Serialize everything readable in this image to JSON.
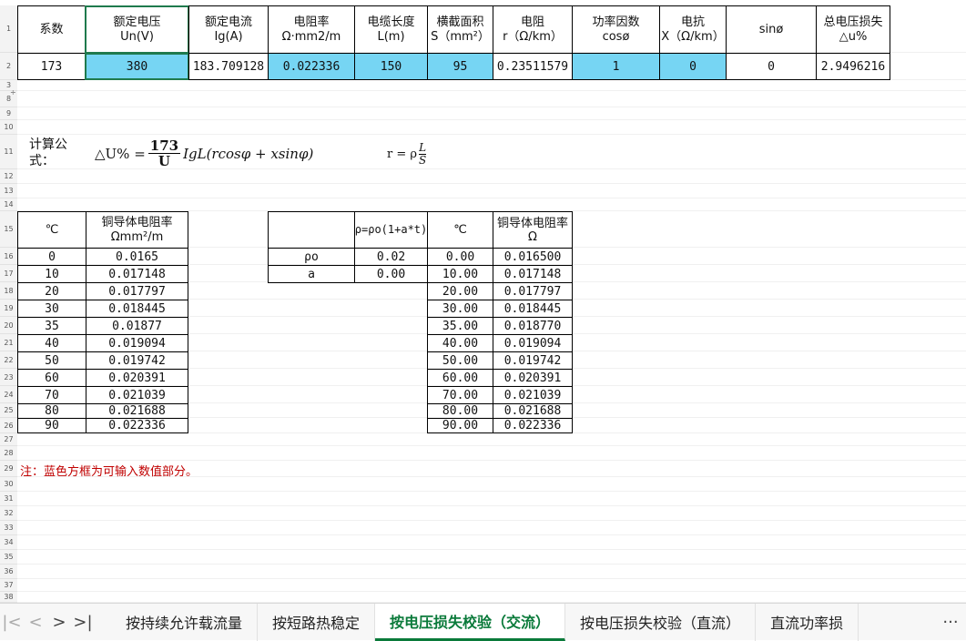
{
  "row_headers": [
    "1",
    "2",
    "3",
    "8",
    "9",
    "10",
    "11",
    "12",
    "13",
    "14",
    "15",
    "16",
    "17",
    "18",
    "19",
    "20",
    "21",
    "22",
    "23",
    "24",
    "25",
    "26",
    "27",
    "28",
    "29",
    "30",
    "31",
    "32",
    "33",
    "34",
    "35",
    "36",
    "37",
    "38"
  ],
  "main_table": {
    "headers": [
      [
        "系数",
        ""
      ],
      [
        "额定电压",
        "Un(V)"
      ],
      [
        "额定电流",
        "Ig(A)"
      ],
      [
        "电阻率",
        "Ω·mm2/m"
      ],
      [
        "电缆长度",
        "L(m)"
      ],
      [
        "横截面积",
        "S（mm²）"
      ],
      [
        "电阻",
        "r（Ω/km）"
      ],
      [
        "功率因数",
        "cosø"
      ],
      [
        "电抗",
        "X（Ω/km）"
      ],
      [
        "sinø",
        ""
      ],
      [
        "总电压损失",
        "△u%"
      ]
    ],
    "values": [
      "173",
      "380",
      "183.709128",
      "0.022336",
      "150",
      "95",
      "0.23511579",
      "1",
      "0",
      "0",
      "2.9496216"
    ]
  },
  "formula": {
    "label": "计算公式：",
    "lhs": "△U% =",
    "frac_num": "173",
    "frac_den": "U",
    "rhs": "IgL(rcosφ + xsinφ)",
    "r_lhs": "r = ρ",
    "r_num": "L",
    "r_den": "S"
  },
  "table_left": {
    "header": [
      "℃",
      "铜导体电阻率 Ωmm²/m"
    ],
    "rows": [
      [
        "0",
        "0.0165"
      ],
      [
        "10",
        "0.017148"
      ],
      [
        "20",
        "0.017797"
      ],
      [
        "30",
        "0.018445"
      ],
      [
        "35",
        "0.01877"
      ],
      [
        "40",
        "0.019094"
      ],
      [
        "50",
        "0.019742"
      ],
      [
        "60",
        "0.020391"
      ],
      [
        "70",
        "0.021039"
      ],
      [
        "80",
        "0.021688"
      ],
      [
        "90",
        "0.022336"
      ]
    ]
  },
  "table_mid": {
    "header": [
      "",
      "ρ=ρo(1+a*t)"
    ],
    "rows": [
      [
        "ρo",
        "0.02"
      ],
      [
        "a",
        "0.00"
      ]
    ]
  },
  "table_right": {
    "header": [
      "℃",
      "铜导体电阻率 Ω"
    ],
    "rows": [
      [
        "0.00",
        "0.016500"
      ],
      [
        "10.00",
        "0.017148"
      ],
      [
        "20.00",
        "0.017797"
      ],
      [
        "30.00",
        "0.018445"
      ],
      [
        "35.00",
        "0.018770"
      ],
      [
        "40.00",
        "0.019094"
      ],
      [
        "50.00",
        "0.019742"
      ],
      [
        "60.00",
        "0.020391"
      ],
      [
        "70.00",
        "0.021039"
      ],
      [
        "80.00",
        "0.021688"
      ],
      [
        "90.00",
        "0.022336"
      ]
    ]
  },
  "note": "注：蓝色方框为可输入数值部分。",
  "input_color": "#76d5f3",
  "tabs": {
    "items": [
      "按持续允许载流量",
      "按短路热稳定",
      "按电压损失校验（交流）",
      "按电压损失校验（直流）",
      "直流功率损"
    ],
    "active_index": 2,
    "nav_icons": [
      "first-sheet-icon",
      "prev-sheet-icon",
      "next-sheet-icon",
      "last-sheet-icon"
    ],
    "more": "···"
  }
}
